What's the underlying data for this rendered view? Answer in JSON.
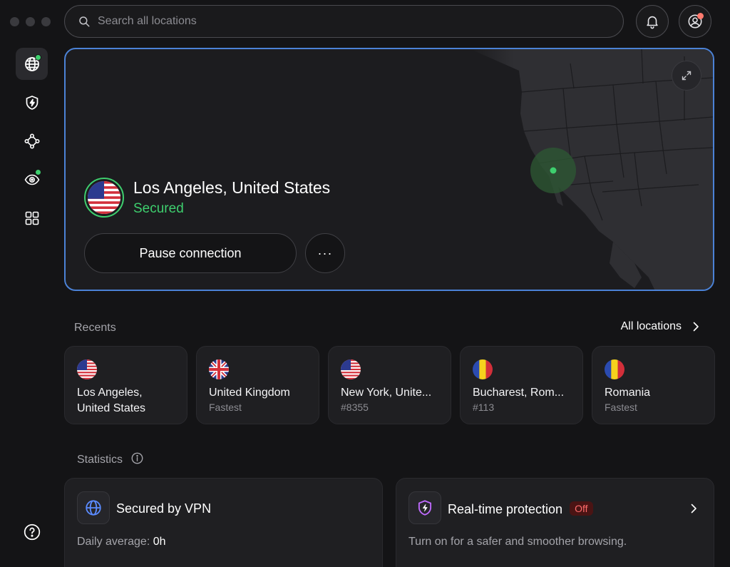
{
  "search": {
    "placeholder": "Search all locations"
  },
  "connection": {
    "location": "Los Angeles, United States",
    "status": "Secured",
    "pause_label": "Pause connection",
    "more_label": "···"
  },
  "recents": {
    "label": "Recents",
    "all_label": "All locations",
    "items": [
      {
        "name": "Los Angeles, United States",
        "sub": "",
        "flag": "us"
      },
      {
        "name": "United Kingdom",
        "sub": "Fastest",
        "flag": "uk"
      },
      {
        "name": "New York, Unite...",
        "sub": "#8355",
        "flag": "us"
      },
      {
        "name": "Bucharest, Rom...",
        "sub": "#113",
        "flag": "ro"
      },
      {
        "name": "Romania",
        "sub": "Fastest",
        "flag": "ro"
      }
    ]
  },
  "statistics": {
    "label": "Statistics",
    "vpn": {
      "title": "Secured by VPN",
      "avg_label": "Daily average: ",
      "avg_value": "0h"
    },
    "protection": {
      "title": "Real-time protection",
      "badge": "Off",
      "desc": "Turn on for a safer and smoother browsing."
    }
  },
  "colors": {
    "accent": "#4b82d6",
    "secured": "#3ecf6e",
    "notification": "#ff7a6e",
    "off_badge": "#ff6b6b"
  },
  "icons": {
    "sidebar": [
      "globe-icon",
      "shield-bolt-icon",
      "meshnet-icon",
      "eye-radar-icon",
      "apps-grid-icon"
    ],
    "help": "help-icon"
  }
}
